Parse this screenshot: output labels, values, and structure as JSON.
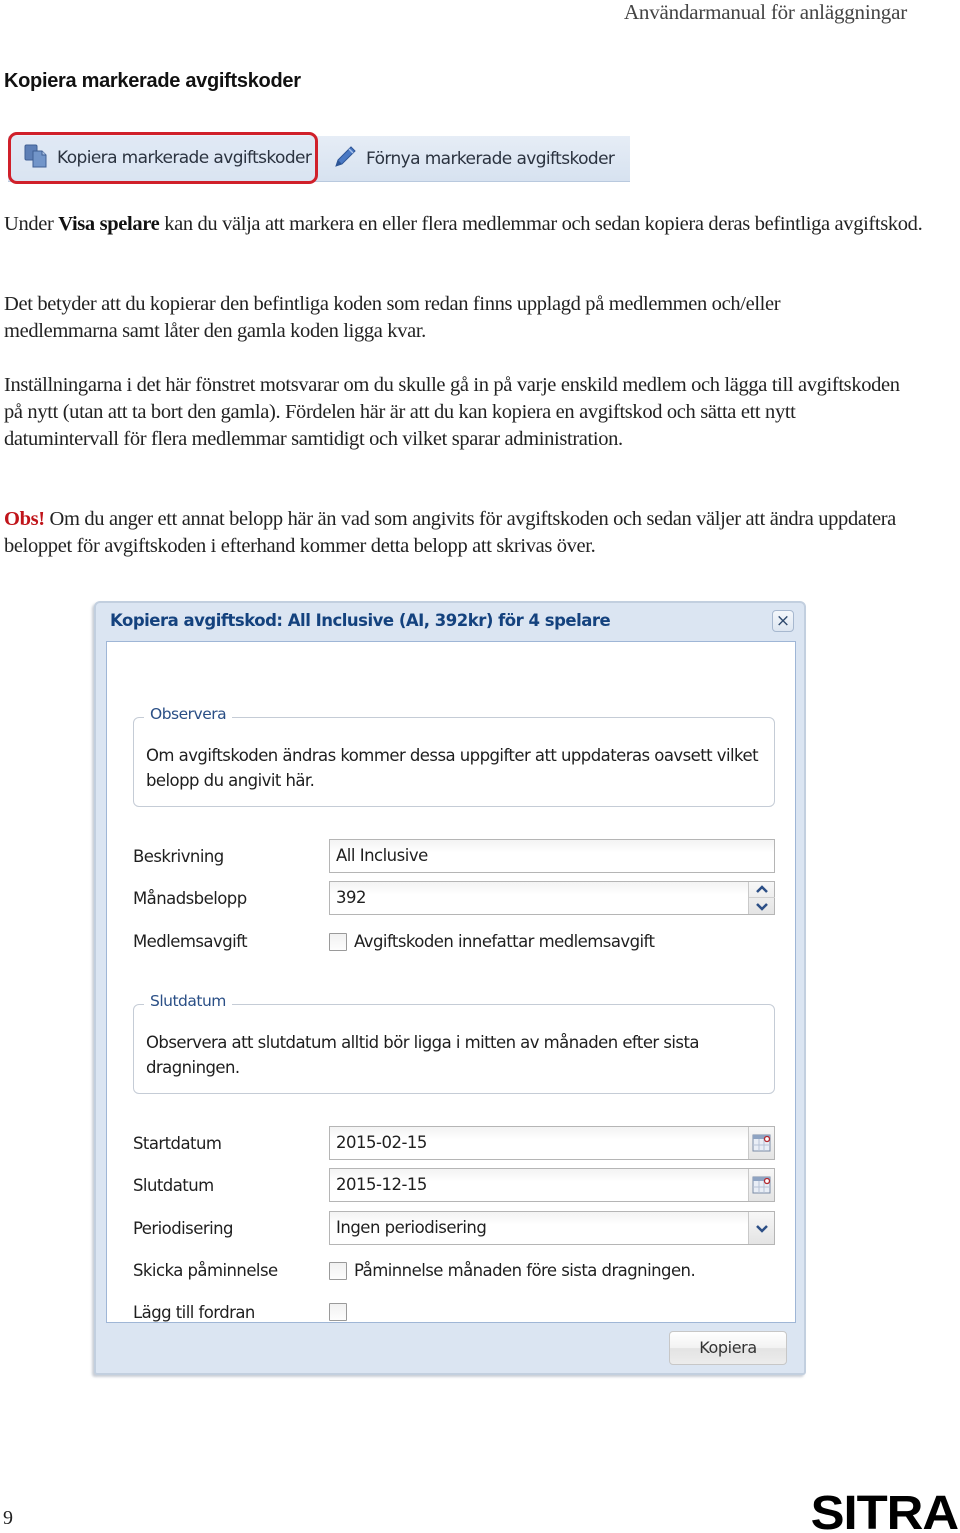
{
  "header": {
    "running_title": "Användarmanual för anläggningar"
  },
  "section": {
    "title": "Kopiera markerade avgiftskoder"
  },
  "toolbar": {
    "copy_label": "Kopiera markerade avgiftskoder",
    "copy_icon": "copy-documents-icon",
    "renew_label": "Förnya markerade avgiftskoder",
    "renew_icon": "pencil-icon",
    "highlight_color": "#d0202a"
  },
  "paragraphs": {
    "p1_prefix": "Under ",
    "p1_bold": "Visa spelare",
    "p1_suffix": " kan du välja att markera en eller flera medlemmar och sedan kopiera deras befintliga avgiftskod.",
    "p2": "Det betyder att du kopierar den befintliga koden som redan finns upplagd på medlemmen och/eller medlemmarna samt låter den gamla koden ligga kvar.",
    "p3": "Inställningarna i det här fönstret motsvarar om du skulle gå in på varje enskild medlem och lägga till avgiftskoden på nytt (utan att ta bort den gamla). Fördelen här är att du kan kopiera en avgiftskod och sätta ett nytt datumintervall för flera medlemmar samtidigt och vilket sparar administration.",
    "p4_prefix": "Obs!",
    "p4_text": " Om du anger ett annat belopp här än vad som angivits för avgiftskoden och sedan väljer att ändra uppdatera beloppet för avgiftskoden i efterhand kommer detta belopp att skrivas över.",
    "obs_color": "#c0141a"
  },
  "dialog": {
    "title": "Kopiera avgiftskod: All Inclusive (AI, 392kr) för 4 spelare",
    "close_icon": "close-icon",
    "observera": {
      "legend": "Observera",
      "text": "Om avgiftskoden ändras kommer dessa uppgifter att uppdateras oavsett vilket belopp du angivit här."
    },
    "fields": {
      "beskrivning": {
        "label": "Beskrivning",
        "value": "All Inclusive"
      },
      "manadsbelopp": {
        "label": "Månadsbelopp",
        "value": "392"
      },
      "medlemsavgift": {
        "label": "Medlemsavgift",
        "checkbox_label": "Avgiftskoden innefattar medlemsavgift",
        "checked": false
      }
    },
    "slutdatum_info": {
      "legend": "Slutdatum",
      "text": "Observera att slutdatum alltid bör ligga i mitten av månaden efter sista dragningen."
    },
    "fields2": {
      "startdatum": {
        "label": "Startdatum",
        "value": "2015-02-15"
      },
      "slutdatum": {
        "label": "Slutdatum",
        "value": "2015-12-15"
      },
      "periodisering": {
        "label": "Periodisering",
        "value": "Ingen periodisering"
      },
      "paminnelse": {
        "label": "Skicka påminnelse",
        "checkbox_label": "Påminnelse månaden före sista dragningen.",
        "checked": false
      },
      "fordran": {
        "label": "Lägg till fordran",
        "checked": false
      }
    },
    "submit_label": "Kopiera",
    "title_color": "#14427e"
  },
  "footer": {
    "page_number": "9",
    "brand": "SITRA"
  }
}
